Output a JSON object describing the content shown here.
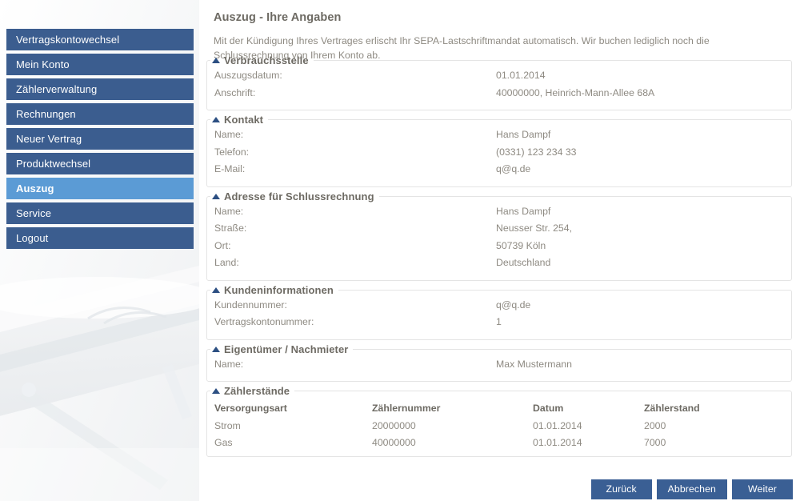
{
  "app": {
    "title": "Auszug - Ihre Angaben",
    "accent_blue": "#3b5d8f",
    "active_blue": "#5b9bd5",
    "button_blue": "#3a5f94",
    "heading_color": "#6d6a63",
    "text_color": "#8e8a82"
  },
  "sidebar": {
    "items": [
      {
        "label": "Vertragskontowechsel",
        "active": false
      },
      {
        "label": "Mein Konto",
        "active": false
      },
      {
        "label": "Zählerverwaltung",
        "active": false
      },
      {
        "label": "Rechnungen",
        "active": false
      },
      {
        "label": "Neuer Vertrag",
        "active": false
      },
      {
        "label": "Produktwechsel",
        "active": false
      },
      {
        "label": "Auszug",
        "active": true
      },
      {
        "label": "Service",
        "active": false
      },
      {
        "label": "Logout",
        "active": false
      }
    ]
  },
  "main": {
    "page_title": "Auszug - Ihre Angaben",
    "intro": "Mit der Kündigung Ihres Vertrages erlischt Ihr SEPA-Lastschriftmandat automatisch. Wir buchen lediglich noch die Schlussrechnung von Ihrem Konto ab.",
    "sections": [
      {
        "id": "verbrauchsstelle",
        "legend": "Verbrauchsstelle",
        "rows": [
          {
            "label": "Auszugsdatum:",
            "value": "01.01.2014"
          },
          {
            "label": "Anschrift:",
            "value": "40000000, Heinrich-Mann-Allee 68A"
          }
        ]
      },
      {
        "id": "kontakt",
        "legend": "Kontakt",
        "rows": [
          {
            "label": "Name:",
            "value": "Hans Dampf"
          },
          {
            "label": "Telefon:",
            "value": "(0331) 123 234 33"
          },
          {
            "label": "E-Mail:",
            "value": "q@q.de"
          }
        ]
      },
      {
        "id": "adresse-fuer-schlussrechnung",
        "legend": "Adresse für Schlussrechnung",
        "rows": [
          {
            "label": "Name:",
            "value": "Hans Dampf"
          },
          {
            "label": "Straße:",
            "value": "Neusser Str. 254,"
          },
          {
            "label": "Ort:",
            "value": "50739 Köln"
          },
          {
            "label": "Land:",
            "value": "Deutschland"
          }
        ]
      },
      {
        "id": "kundeninformationen",
        "legend": "Kundeninformationen",
        "rows": [
          {
            "label": "Kundennummer:",
            "value": "q@q.de"
          },
          {
            "label": "Vertragskontonummer:",
            "value": "1"
          }
        ]
      },
      {
        "id": "eigentuemer-nachmieter",
        "legend": "Eigentümer / Nachmieter",
        "rows": [
          {
            "label": "Name:",
            "value": "Max Mustermann"
          }
        ]
      }
    ],
    "meter_section": {
      "id": "zaehlerstaende",
      "legend": "Zählerstände",
      "columns": [
        "Versorgungsart",
        "Zählernummer",
        "Datum",
        "Zählerstand"
      ],
      "rows": [
        [
          "Strom",
          "20000000",
          "01.01.2014",
          "2000"
        ],
        [
          "Gas",
          "40000000",
          "01.01.2014",
          "7000"
        ]
      ]
    },
    "buttons": [
      {
        "label": "Zurück",
        "name": "back-button"
      },
      {
        "label": "Abbrechen",
        "name": "cancel-button"
      },
      {
        "label": "Weiter",
        "name": "next-button"
      }
    ]
  }
}
